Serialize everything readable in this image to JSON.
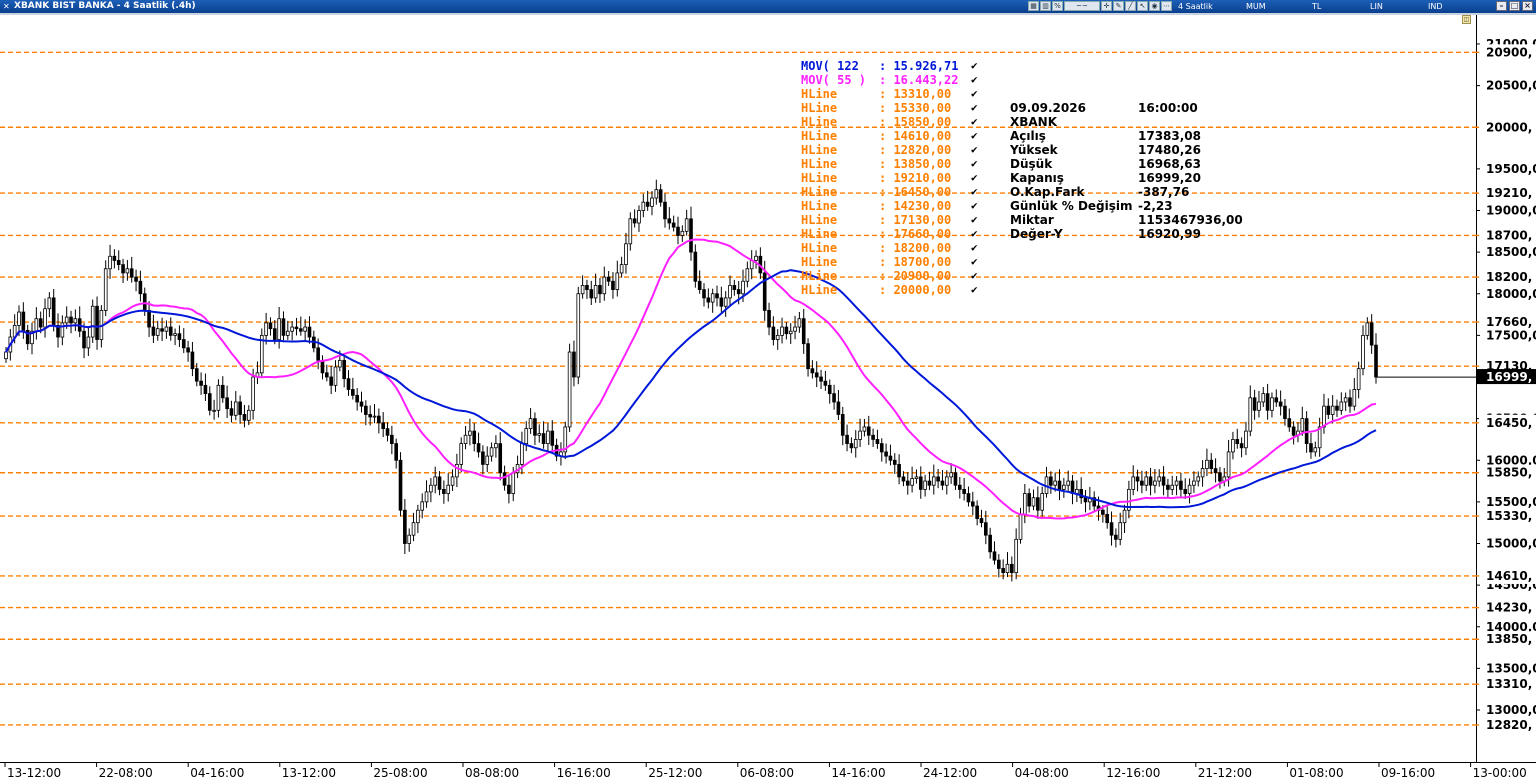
{
  "window": {
    "title": "XBANK BIST BANKA - 4 Saatlik (.4h)",
    "period": "4 Saatlik",
    "mode_buttons": [
      "MUM",
      "TL",
      "LIN",
      "IND"
    ]
  },
  "colors": {
    "hline": "#ff8000",
    "mov122": "#0018d8",
    "mov55": "#ff20ff",
    "candle_up": "#ffffff",
    "candle_down": "#000000",
    "title_bar": "#0a3f8e"
  },
  "legend": [
    {
      "name": "MOV( 122 ",
      "value": ": 15.926,71",
      "color": "#0018d8"
    },
    {
      "name": "MOV( 55 )",
      "value": ": 16.443,22",
      "color": "#ff20ff"
    },
    {
      "name": "HLine",
      "value": ": 13310,00",
      "color": "#ff8000"
    },
    {
      "name": "HLine",
      "value": ": 15330,00",
      "color": "#ff8000"
    },
    {
      "name": "HLine",
      "value": ": 15850,00",
      "color": "#ff8000"
    },
    {
      "name": "HLine",
      "value": ": 14610,00",
      "color": "#ff8000"
    },
    {
      "name": "HLine",
      "value": ": 12820,00",
      "color": "#ff8000"
    },
    {
      "name": "HLine",
      "value": ": 13850,00",
      "color": "#ff8000"
    },
    {
      "name": "HLine",
      "value": ": 19210,00",
      "color": "#ff8000"
    },
    {
      "name": "HLine",
      "value": ": 16450,00",
      "color": "#ff8000"
    },
    {
      "name": "HLine",
      "value": ": 14230,00",
      "color": "#ff8000"
    },
    {
      "name": "HLine",
      "value": ": 17130,00",
      "color": "#ff8000"
    },
    {
      "name": "HLine",
      "value": ": 17660,00",
      "color": "#ff8000"
    },
    {
      "name": "HLine",
      "value": ": 18200,00",
      "color": "#ff8000"
    },
    {
      "name": "HLine",
      "value": ": 18700,00",
      "color": "#ff8000"
    },
    {
      "name": "HLine",
      "value": ": 20900,00",
      "color": "#ff8000"
    },
    {
      "name": "HLine",
      "value": ": 20000,00",
      "color": "#ff8000"
    }
  ],
  "legend_check": "✔",
  "info_panel": [
    {
      "key": "09.09.2026",
      "value": "16:00:00"
    },
    {
      "key": "XBANK",
      "value": ""
    },
    {
      "key": "Açılış",
      "value": "17383,08"
    },
    {
      "key": "Yüksek",
      "value": "17480,26"
    },
    {
      "key": "Düşük",
      "value": "16968,63"
    },
    {
      "key": "Kapanış",
      "value": "16999,20"
    },
    {
      "key": "O.Kap.Fark",
      "value": "-387,76"
    },
    {
      "key": "Günlük % Değişim",
      "value": "-2,23"
    },
    {
      "key": "Miktar",
      "value": "1153467936,00"
    },
    {
      "key": "Değer-Y",
      "value": "16920,99"
    }
  ],
  "chart_data": {
    "type": "candlestick",
    "symbol": "XBANK",
    "title": "",
    "xlabel": "",
    "ylabel": "",
    "ylim": [
      12500,
      21000
    ],
    "y_ticks": [
      {
        "value": 21000,
        "label": "21000,0"
      },
      {
        "value": 20500,
        "label": "20500,0"
      },
      {
        "value": 20000,
        "label": "20000,0"
      },
      {
        "value": 19500,
        "label": "19500,0"
      },
      {
        "value": 19000,
        "label": "19000,0"
      },
      {
        "value": 18500,
        "label": "18500,0"
      },
      {
        "value": 18000,
        "label": "18000,0"
      },
      {
        "value": 17500,
        "label": "17500,0"
      },
      {
        "value": 17000,
        "label": "17000,0"
      },
      {
        "value": 16500,
        "label": "16500,0"
      },
      {
        "value": 16000,
        "label": "16000,0"
      },
      {
        "value": 15500,
        "label": "15500,0"
      },
      {
        "value": 15000,
        "label": "15000,0"
      },
      {
        "value": 14500,
        "label": "14500,0"
      },
      {
        "value": 14000,
        "label": "14000,0"
      },
      {
        "value": 13500,
        "label": "13500,0"
      },
      {
        "value": 13000,
        "label": "13000,0"
      }
    ],
    "x_ticks": [
      "13-12:00",
      "22-08:00",
      "04-16:00",
      "13-12:00",
      "25-08:00",
      "08-08:00",
      "16-16:00",
      "25-12:00",
      "06-08:00",
      "14-16:00",
      "24-12:00",
      "04-08:00",
      "12-16:00",
      "21-12:00",
      "01-08:00",
      "09-16:00",
      "13-00:00"
    ],
    "hlines": [
      {
        "value": 20900,
        "label": "20900,"
      },
      {
        "value": 20000,
        "label": "20000,"
      },
      {
        "value": 19210,
        "label": "19210,"
      },
      {
        "value": 18700,
        "label": "18700,"
      },
      {
        "value": 18200,
        "label": "18200,"
      },
      {
        "value": 17660,
        "label": "17660,"
      },
      {
        "value": 17130,
        "label": "17130,"
      },
      {
        "value": 16450,
        "label": "16450,"
      },
      {
        "value": 15850,
        "label": "15850,"
      },
      {
        "value": 15330,
        "label": "15330,"
      },
      {
        "value": 14610,
        "label": "14610,"
      },
      {
        "value": 14230,
        "label": "14230,"
      },
      {
        "value": 13850,
        "label": "13850,"
      },
      {
        "value": 13310,
        "label": "13310,"
      },
      {
        "value": 12820,
        "label": "12820,"
      }
    ],
    "last_price": {
      "value": 16999.2,
      "label": "16999,"
    },
    "closes": [
      17300,
      17480,
      17620,
      17780,
      17560,
      17400,
      17550,
      17700,
      17600,
      17820,
      17950,
      17620,
      17480,
      17650,
      17720,
      17650,
      17700,
      17550,
      17350,
      17480,
      17850,
      17450,
      17800,
      18300,
      18450,
      18400,
      18350,
      18250,
      18300,
      18200,
      18150,
      18000,
      17800,
      17600,
      17500,
      17580,
      17550,
      17600,
      17500,
      17520,
      17450,
      17350,
      17300,
      17100,
      16950,
      16900,
      16800,
      16600,
      16600,
      16900,
      16750,
      16620,
      16540,
      16700,
      16550,
      16480,
      16600,
      17000,
      17050,
      17500,
      17650,
      17580,
      17450,
      17700,
      17500,
      17550,
      17600,
      17580,
      17550,
      17600,
      17480,
      17350,
      17200,
      17050,
      17000,
      16900,
      17120,
      17200,
      16980,
      16850,
      16780,
      16700,
      16650,
      16550,
      16520,
      16530,
      16450,
      16380,
      16300,
      16200,
      16000,
      15400,
      15000,
      15100,
      15250,
      15400,
      15500,
      15620,
      15700,
      15800,
      15650,
      15600,
      15700,
      15800,
      15950,
      16200,
      16300,
      16350,
      16200,
      16100,
      15950,
      16050,
      16150,
      16200,
      15850,
      15700,
      15600,
      15850,
      15950,
      16200,
      16380,
      16500,
      16300,
      16320,
      16200,
      16350,
      16180,
      16050,
      16100,
      16400,
      17300,
      17000,
      18000,
      18100,
      18050,
      17950,
      18100,
      18000,
      18200,
      18150,
      18050,
      18250,
      18350,
      18600,
      18900,
      18850,
      19000,
      19100,
      19050,
      19150,
      19250,
      19100,
      18900,
      18850,
      18800,
      18700,
      18750,
      18900,
      18500,
      18150,
      18050,
      17950,
      17900,
      18000,
      17950,
      17850,
      17950,
      18100,
      18050,
      18000,
      18150,
      18300,
      18400,
      18450,
      18250,
      17800,
      17600,
      17450,
      17500,
      17600,
      17520,
      17550,
      17600,
      17700,
      17400,
      17100,
      17050,
      17000,
      16950,
      16900,
      16800,
      16700,
      16550,
      16300,
      16200,
      16150,
      16250,
      16350,
      16400,
      16300,
      16250,
      16200,
      16100,
      16050,
      16000,
      15950,
      15800,
      15750,
      15700,
      15780,
      15800,
      15650,
      15750,
      15700,
      15800,
      15750,
      15700,
      15800,
      15850,
      15700,
      15650,
      15600,
      15500,
      15450,
      15300,
      15250,
      15100,
      14900,
      14800,
      14700,
      14650,
      14750,
      14650,
      15050,
      15350,
      15600,
      15450,
      15550,
      15400,
      15600,
      15800,
      15700,
      15750,
      15650,
      15700,
      15750,
      15600,
      15650,
      15550,
      15500,
      15550,
      15450,
      15400,
      15350,
      15250,
      15100,
      15050,
      15250,
      15400,
      15650,
      15800,
      15750,
      15700,
      15800,
      15700,
      15750,
      15800,
      15700,
      15650,
      15700,
      15750,
      15650,
      15600,
      15700,
      15750,
      15800,
      15900,
      16000,
      15900,
      15850,
      15750,
      15800,
      16100,
      16250,
      16200,
      16150,
      16350,
      16750,
      16600,
      16700,
      16800,
      16600,
      16750,
      16700,
      16650,
      16500,
      16400,
      16300,
      16350,
      16500,
      16200,
      16100,
      16150,
      16400,
      16650,
      16550,
      16650,
      16600,
      16700,
      16750,
      16650,
      16850,
      17100,
      17500,
      17650,
      17383,
      16999
    ]
  }
}
